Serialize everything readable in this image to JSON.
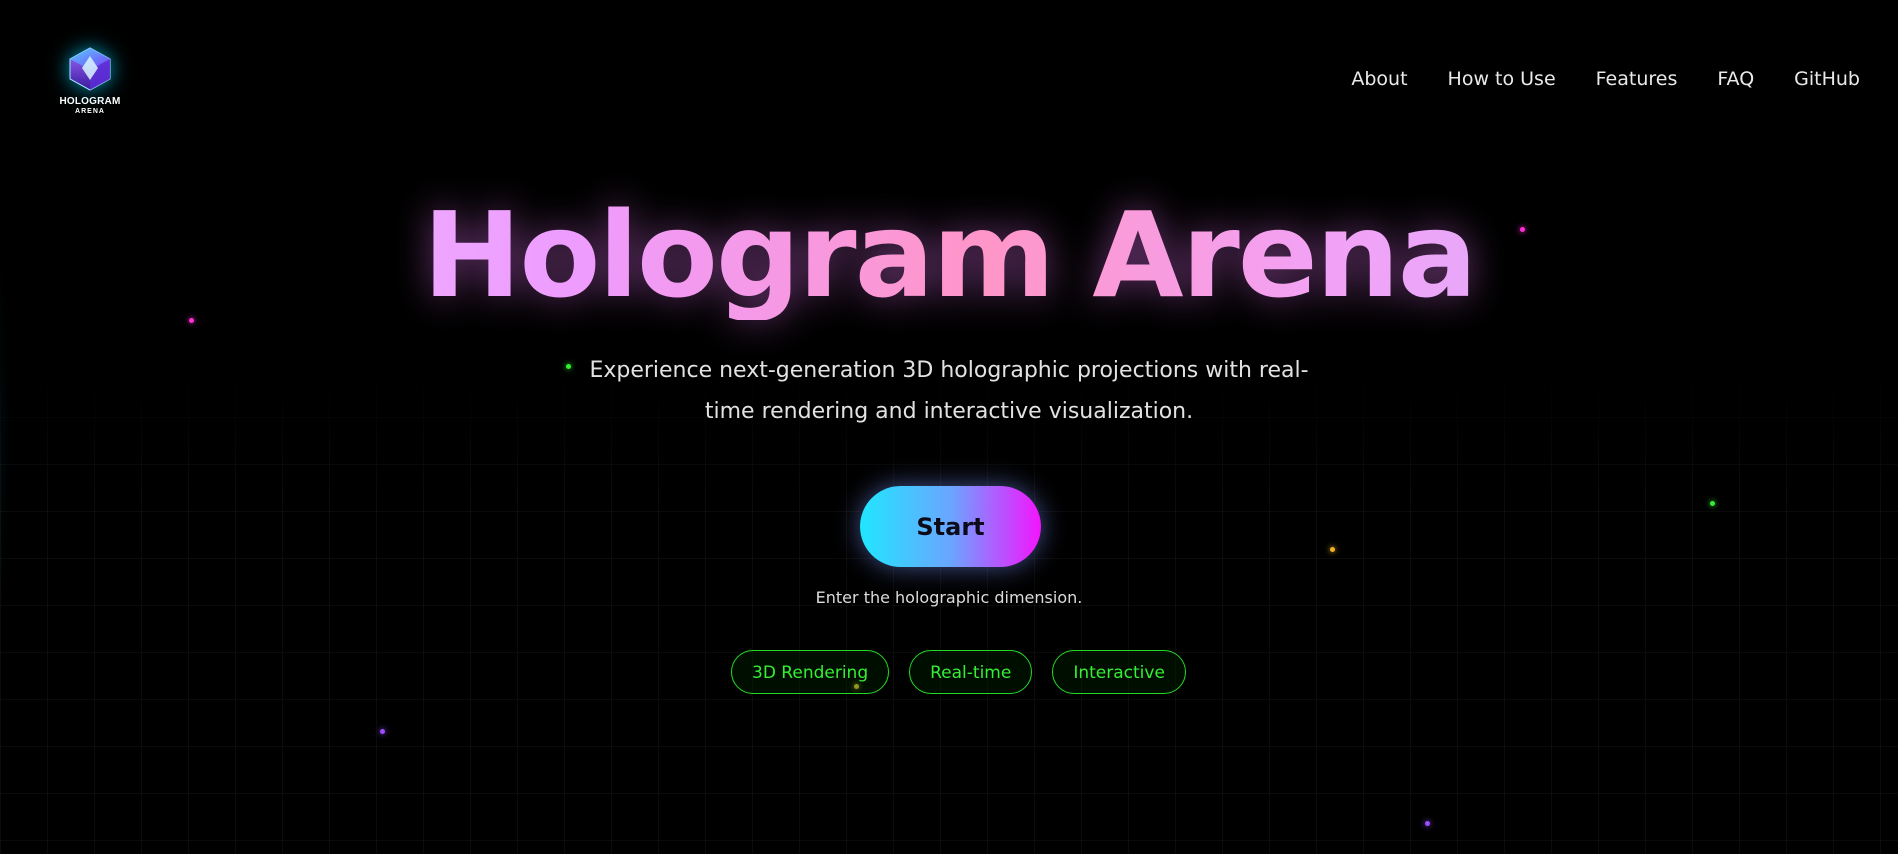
{
  "logo": {
    "title": "HOLOGRAM",
    "subtitle": "ARENA",
    "icon": "hologram-cube-icon"
  },
  "nav": {
    "items": [
      "About",
      "How to Use",
      "Features",
      "FAQ",
      "GitHub"
    ]
  },
  "hero": {
    "title": "Hologram Arena",
    "tagline": "Experience next-generation 3D holographic projections with real-time rendering and interactive visualization.",
    "start_label": "Start",
    "caption": "Enter the holographic dimension.",
    "chips": [
      "3D Rendering",
      "Real-time",
      "Interactive"
    ]
  },
  "colors": {
    "background": "#000000",
    "title_gradient_start": "#f0c4ff",
    "title_gradient_mid": "#ff96c8",
    "title_gradient_end": "#cdb6ff",
    "button_gradient_start": "#20e6ff",
    "button_gradient_end": "#f414ff",
    "chip_accent": "#26d926"
  }
}
